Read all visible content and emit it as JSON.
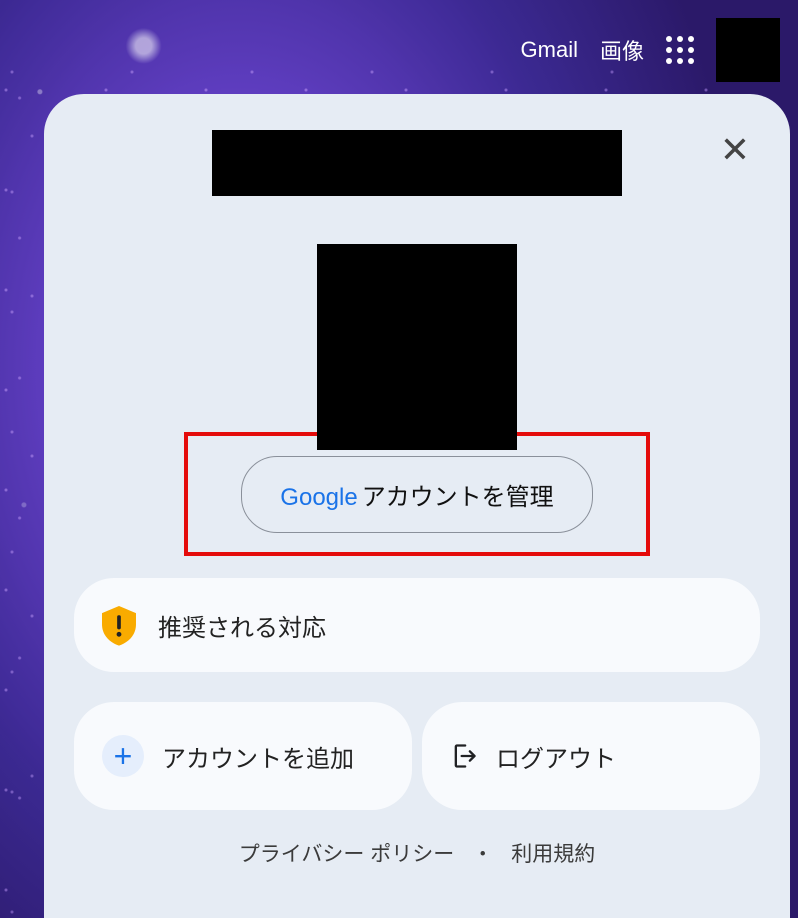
{
  "topbar": {
    "gmail": "Gmail",
    "images": "画像"
  },
  "panel": {
    "manage_prefix": "Google",
    "manage_rest": " アカウントを管理",
    "recommended": "推奨される対応",
    "add_account": "アカウントを追加",
    "logout": "ログアウト"
  },
  "footer": {
    "privacy": "プライバシー ポリシー",
    "separator": "・",
    "terms": "利用規約"
  }
}
